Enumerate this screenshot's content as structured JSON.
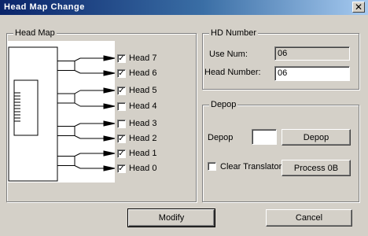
{
  "window": {
    "title": "Head Map Change",
    "close_glyph": "✕"
  },
  "head_map": {
    "legend": "Head Map",
    "heads": [
      {
        "label": "Head 7",
        "checked": true
      },
      {
        "label": "Head 6",
        "checked": true
      },
      {
        "label": "Head 5",
        "checked": true
      },
      {
        "label": "Head 4",
        "checked": false
      },
      {
        "label": "Head 3",
        "checked": false
      },
      {
        "label": "Head 2",
        "checked": true
      },
      {
        "label": "Head 1",
        "checked": true
      },
      {
        "label": "Head 0",
        "checked": true
      }
    ]
  },
  "hd_number": {
    "legend": "HD Number",
    "use_num_label": "Use Num:",
    "use_num_value": "06",
    "head_number_label": "Head Number:",
    "head_number_value": "06"
  },
  "depop": {
    "legend": "Depop",
    "depop_label": "Depop",
    "depop_value": "",
    "depop_button": "Depop",
    "clear_translator_label": "Clear Translator",
    "clear_translator_checked": false,
    "process_button": "Process 0B"
  },
  "footer": {
    "modify_button": "Modify",
    "cancel_button": "Cancel"
  }
}
